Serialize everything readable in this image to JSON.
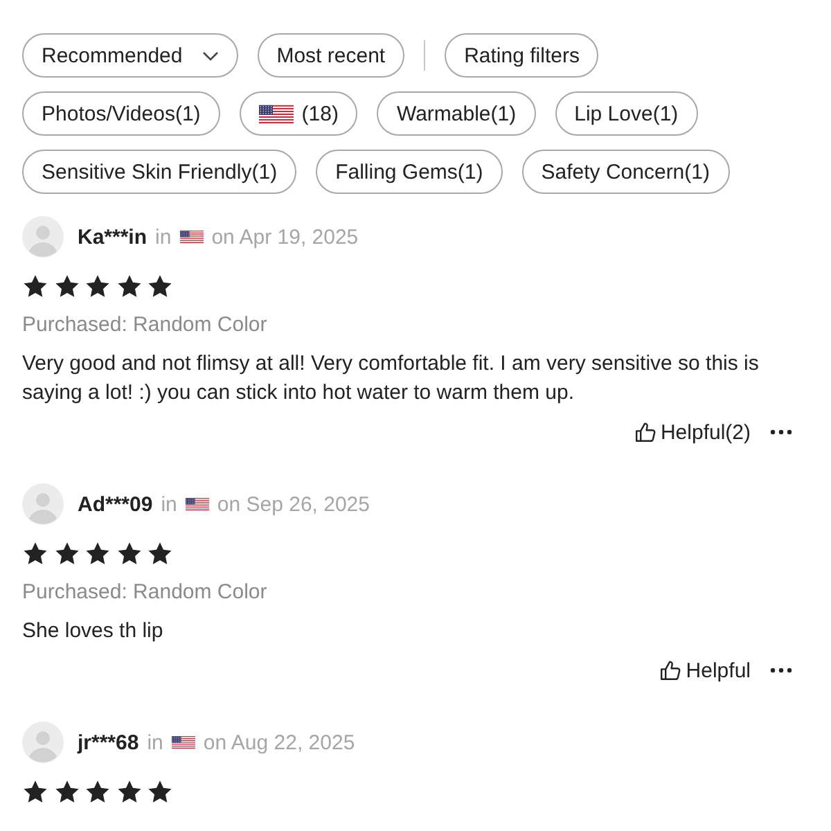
{
  "sort_controls": [
    {
      "kind": "dropdown",
      "label": "Recommended"
    },
    {
      "kind": "chip",
      "label": "Most recent"
    }
  ],
  "rating_filter": {
    "label": "Rating filters"
  },
  "tag_filters": [
    {
      "kind": "text",
      "label": "Photos/Videos(1)"
    },
    {
      "kind": "flag",
      "label": "(18)"
    },
    {
      "kind": "text",
      "label": "Warmable(1)"
    },
    {
      "kind": "text",
      "label": "Lip Love(1)"
    },
    {
      "kind": "text",
      "label": "Sensitive Skin Friendly(1)"
    },
    {
      "kind": "text",
      "label": "Falling Gems(1)"
    },
    {
      "kind": "text",
      "label": "Safety Concern(1)"
    }
  ],
  "reviews": [
    {
      "reviewer": "Ka***in",
      "country_prefix": "in",
      "date": "on Apr 19, 2025",
      "stars": 5,
      "purchased": "Purchased: Random Color",
      "text": "Very good and not flimsy at all! Very comfortable fit. I am very sensitive so this is saying a lot! :) you can stick into hot water to warm them up.",
      "helpful": "Helpful(2)"
    },
    {
      "reviewer": "Ad***09",
      "country_prefix": "in",
      "date": "on Sep 26, 2025",
      "stars": 5,
      "purchased": "Purchased: Random Color",
      "text": "She loves th lip",
      "helpful": "Helpful"
    },
    {
      "reviewer": "jr***68",
      "country_prefix": "in",
      "date": "on Aug 22, 2025",
      "stars": 5
    }
  ]
}
